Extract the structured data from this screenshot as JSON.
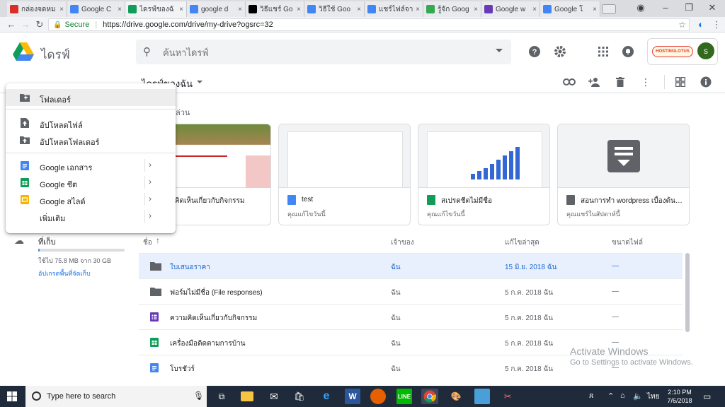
{
  "browser": {
    "tabs": [
      {
        "title": "กล่องจดหม",
        "icon": "gmail-icon",
        "color": "#d93025"
      },
      {
        "title": "Google C",
        "icon": "google-contacts-icon",
        "color": "#4285f4"
      },
      {
        "title": "ไดรฟ์ของฉั",
        "icon": "google-drive-icon",
        "color": "#0f9d58"
      },
      {
        "title": "google d",
        "icon": "google-icon",
        "color": "#4285f4"
      },
      {
        "title": "วิธีแชร์ Go",
        "icon": "medium-icon",
        "color": "#000000"
      },
      {
        "title": "วิธีใช้ Goo",
        "icon": "google-icon",
        "color": "#4285f4"
      },
      {
        "title": "แชร์ไฟล์จา",
        "icon": "google-icon",
        "color": "#4285f4"
      },
      {
        "title": "รู้จัก Goog",
        "icon": "google-chrome-icon",
        "color": "#34a853"
      },
      {
        "title": "Google w",
        "icon": "google-forms-icon",
        "color": "#673ab7"
      },
      {
        "title": "Google โ",
        "icon": "google-icon",
        "color": "#4285f4"
      }
    ],
    "secure_label": "Secure",
    "url": "https://drive.google.com/drive/my-drive?ogsrc=32"
  },
  "drive": {
    "brand": "ไดรฟ์",
    "search_placeholder": "ค้นหาไดรฟ์",
    "account_badge": "HOSTINGLOTUS",
    "avatar_letter": "s",
    "breadcrumb": "ไดรฟ์ของฉัน",
    "quick_access_label": "ล่วน"
  },
  "new_menu": {
    "items": [
      {
        "label": "โฟลเดอร์",
        "icon": "new-folder-icon"
      },
      {
        "label": "อัปโหลดไฟล์",
        "icon": "file-upload-icon"
      },
      {
        "label": "อัปโหลดโฟลเดอร์",
        "icon": "folder-upload-icon"
      },
      {
        "label": "Google เอกสาร",
        "icon": "google-docs-icon"
      },
      {
        "label": "Google ชีต",
        "icon": "google-sheets-icon"
      },
      {
        "label": "Google สไลด์",
        "icon": "google-slides-icon"
      },
      {
        "label": "เพิ่มเติม",
        "icon": ""
      }
    ]
  },
  "storage": {
    "label": "ที่เก็บ",
    "used_text": "ใช้ไป 75.8 MB จาก 30 GB",
    "used_fraction": 0.0025,
    "upgrade_text": "อัปเกรดพื้นที่จัดเก็บ"
  },
  "quick_access": [
    {
      "name": "วามคิดเห็นเกี่ยวกับกิจกรรม",
      "sub": "ต้นนี้",
      "icon": "google-forms-icon",
      "color": "#673ab7"
    },
    {
      "name": "test",
      "sub": "คุณแก้ไขวันนี้",
      "icon": "google-docs-icon",
      "color": "#4285f4"
    },
    {
      "name": "สเปรดชีตไม่มีชื่อ",
      "sub": "คุณแก้ไขวันนี้",
      "icon": "google-sheets-icon",
      "color": "#0f9d58"
    },
    {
      "name": "สอนการทำ wordpress เบื้องต้น.r...",
      "sub": "คุณแชร์ในสัปดาห์นี้",
      "icon": "generic-file-icon",
      "color": "#5f6368"
    }
  ],
  "file_list": {
    "headers": {
      "name": "ชื่อ",
      "owner": "เจ้าของ",
      "modified": "แก้ไขล่าสุด",
      "size": "ขนาดไฟล์"
    },
    "rows": [
      {
        "name": "ใบเสนอราคา",
        "owner": "ฉัน",
        "modified": "15 มิ.ย. 2018 ฉัน",
        "size": "—",
        "type": "folder"
      },
      {
        "name": "ฟอร์มไม่มีชื่อ (File responses)",
        "owner": "ฉัน",
        "modified": "5 ก.ค. 2018 ฉัน",
        "size": "—",
        "type": "folder"
      },
      {
        "name": "ความคิดเห็นเกี่ยวกับกิจกรรม",
        "owner": "ฉัน",
        "modified": "5 ก.ค. 2018 ฉัน",
        "size": "—",
        "type": "form"
      },
      {
        "name": "เครื่องมือติดตามการบ้าน",
        "owner": "ฉัน",
        "modified": "5 ก.ค. 2018 ฉัน",
        "size": "—",
        "type": "sheet"
      },
      {
        "name": "โบรชัวร์",
        "owner": "ฉัน",
        "modified": "5 ก.ค. 2018 ฉัน",
        "size": "—",
        "type": "doc"
      }
    ]
  },
  "watermark": {
    "line1": "Activate Windows",
    "line2": "Go to Settings to activate Windows."
  },
  "taskbar": {
    "search_text": "Type here to search",
    "lang": "ไทย",
    "time": "2:10 PM",
    "date": "7/6/2018"
  }
}
